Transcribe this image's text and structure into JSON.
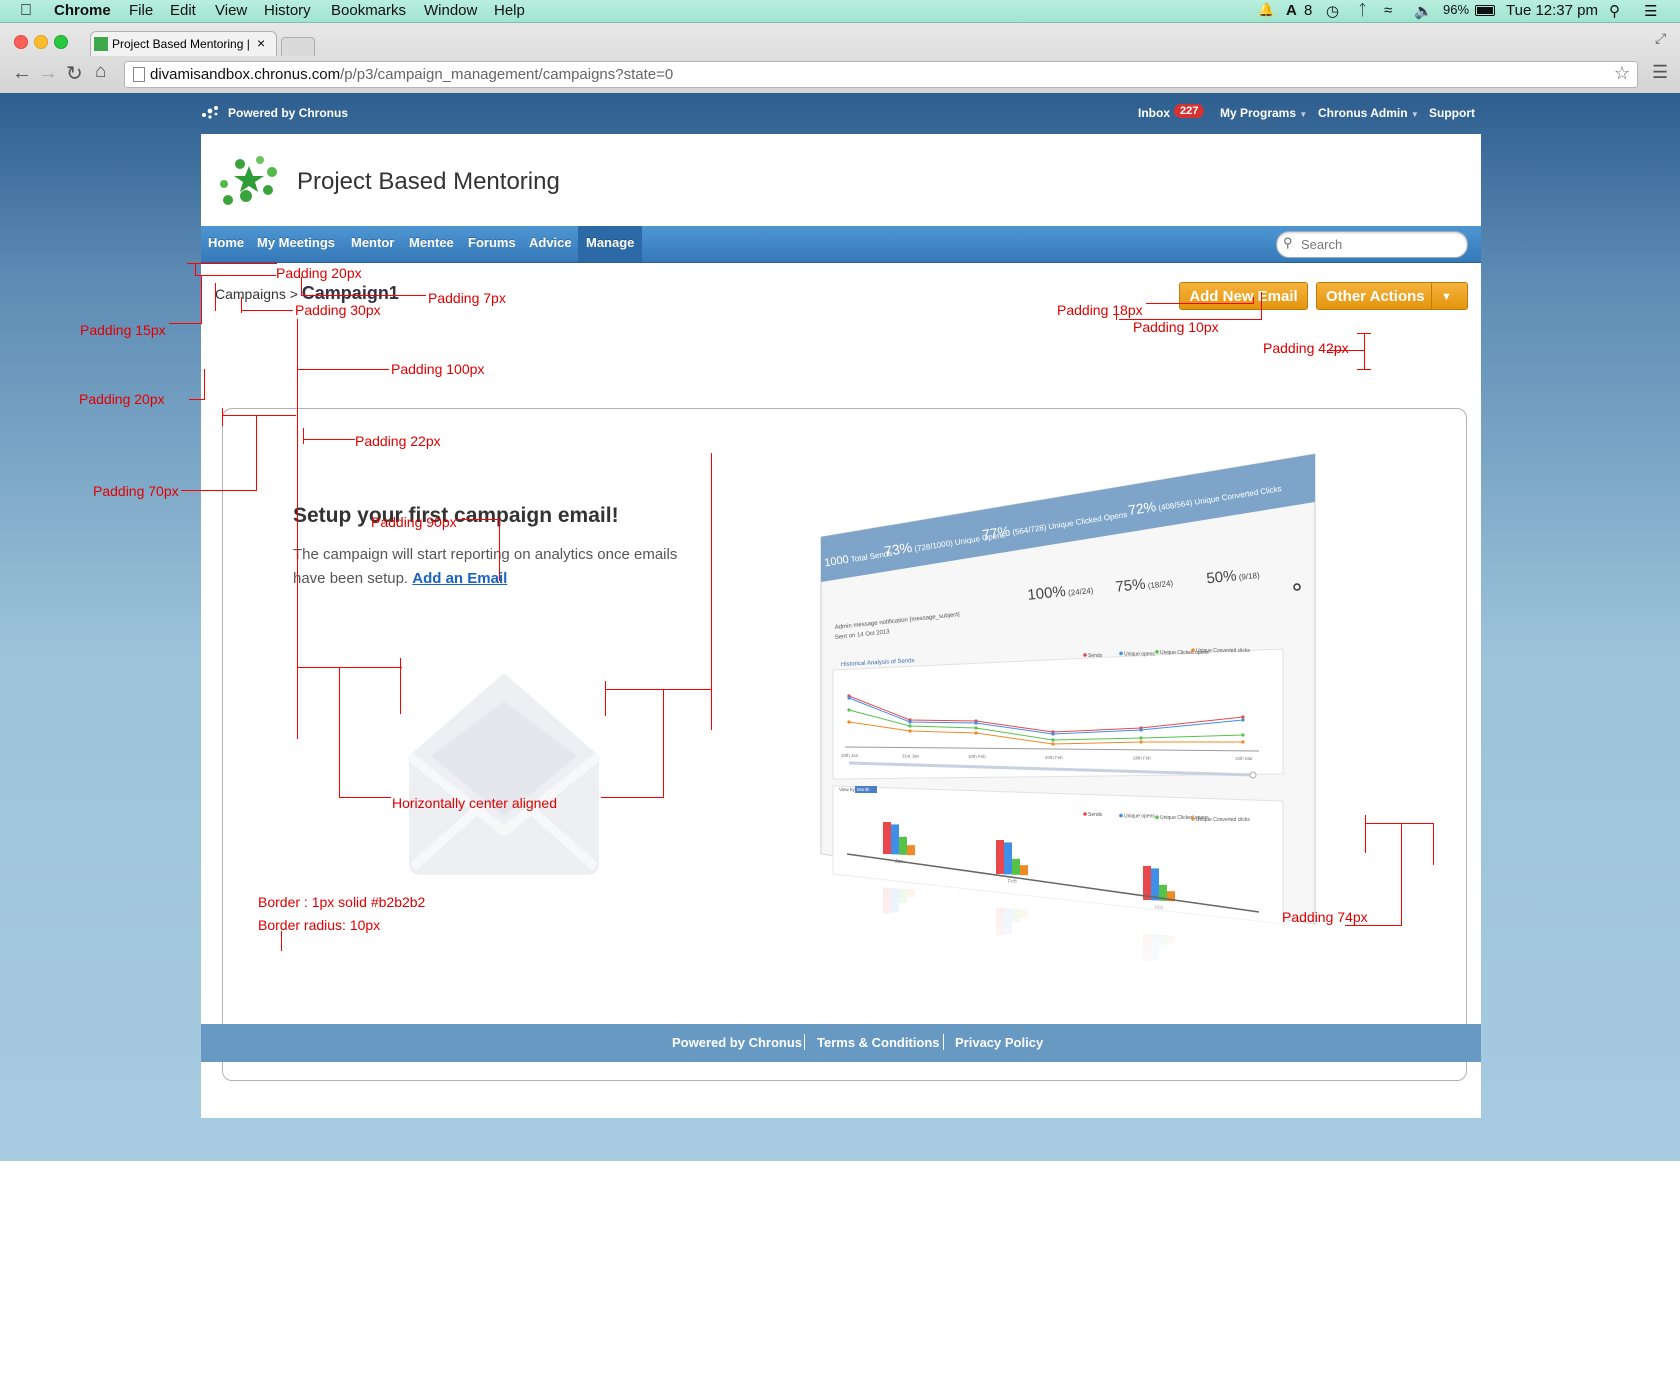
{
  "menubar": {
    "app": "Chrome",
    "items": [
      "File",
      "Edit",
      "View",
      "History",
      "Bookmarks",
      "Window",
      "Help"
    ],
    "status_count": "8",
    "battery": "96%",
    "clock": "Tue 12:37 pm"
  },
  "browser": {
    "tab_title": "Project Based Mentoring |",
    "url_host": "divamisandbox.chronus.com",
    "url_path": "/p/p3/campaign_management/campaigns?state=0"
  },
  "topbar": {
    "powered": "Powered by Chronus",
    "inbox_label": "Inbox",
    "inbox_count": "227",
    "my_programs": "My Programs",
    "admin": "Chronus Admin",
    "support": "Support"
  },
  "header": {
    "title": "Project Based Mentoring"
  },
  "nav": {
    "items": [
      "Home",
      "My Meetings",
      "Mentor",
      "Mentee",
      "Forums",
      "Advice",
      "Manage"
    ],
    "active": "Manage",
    "search_placeholder": "Search"
  },
  "breadcrumb": {
    "parent": "Campaigns",
    "separator": ">",
    "current": "Campaign1"
  },
  "actions": {
    "add_email": "Add New Email",
    "other": "Other Actions"
  },
  "empty_state": {
    "heading": "Setup your first campaign email!",
    "text_line1": "The campaign will start reporting on analytics once emails",
    "text_line2": "have been setup.",
    "link": "Add an Email"
  },
  "preview": {
    "stats": [
      {
        "value": "1000",
        "label": "Total Sends"
      },
      {
        "value": "73%",
        "detail": "(728/1000)",
        "label": "Unique Opens"
      },
      {
        "value": "77%",
        "detail": "(564/728)",
        "label": "Unique Clicked Opens"
      },
      {
        "value": "72%",
        "detail": "(408/564)",
        "label": "Unique Converted Clicks"
      }
    ],
    "row_stats": [
      {
        "value": "100%",
        "detail": "(24/24)"
      },
      {
        "value": "75%",
        "detail": "(18/24)"
      },
      {
        "value": "50%",
        "detail": "(9/18)"
      }
    ],
    "row_title": "Admin message notification {message_subject}",
    "row_date": "Sent on 14 Oct 2013",
    "chart_title": "Historical Analysis of Sends",
    "legend": [
      "Sends",
      "Unique opens",
      "Unique Clicked opens",
      "Unique Converted clicks"
    ],
    "line_x_labels": [
      "20th Jan",
      "31st Jan",
      "10th Feb",
      "20th Feb",
      "28th Feb",
      "10th Mar"
    ],
    "bar_x_labels": [
      "Jan",
      "Feb",
      "Mar"
    ],
    "view_by": "View by",
    "view_option": "Month",
    "colors": {
      "sends": "#e8474c",
      "opens": "#3f8fe8",
      "clicked": "#58c14a",
      "converted": "#f08a24"
    }
  },
  "annotations": {
    "p20_top": "Padding 20px",
    "p7": "Padding 7px",
    "p30": "Padding 30px",
    "p15": "Padding 15px",
    "p18": "Padding 18px",
    "p10": "Padding 10px",
    "p42": "Padding 42px",
    "p100": "Padding 100px",
    "p20_left": "Padding 20px",
    "p22": "Padding 22px",
    "p70": "Padding 70px",
    "p90": "Padding 90px",
    "center": "Horizontally center aligned",
    "border": "Border : 1px solid #b2b2b2",
    "radius": "Border radius: 10px",
    "p74": "Padding 74px"
  },
  "footer": {
    "links": [
      "Powered by Chronus",
      "Terms & Conditions",
      "Privacy Policy"
    ]
  }
}
